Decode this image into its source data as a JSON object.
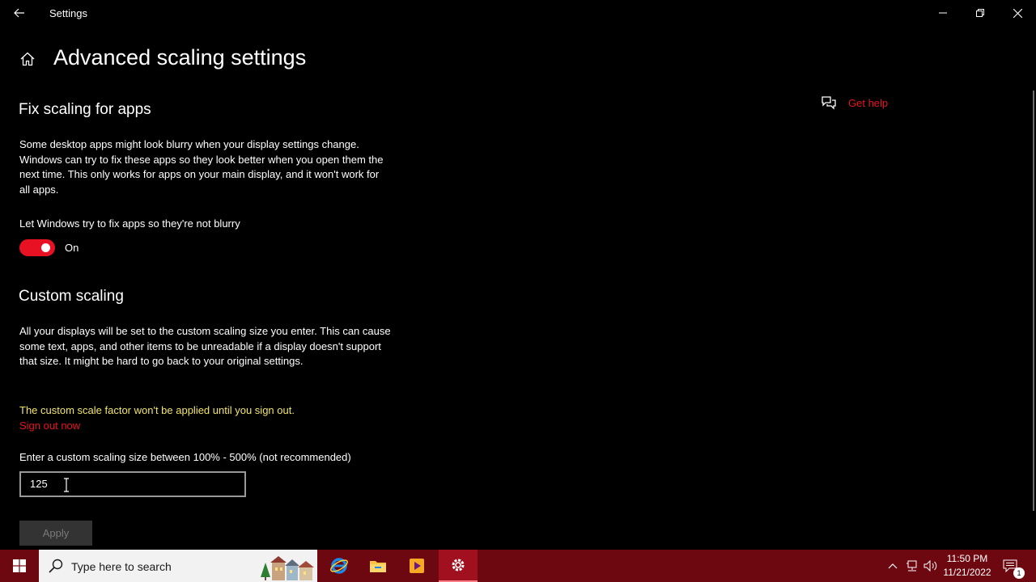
{
  "titlebar": {
    "app_title": "Settings"
  },
  "header": {
    "page_title": "Advanced scaling settings"
  },
  "fix_scaling": {
    "heading": "Fix scaling for apps",
    "description": "Some desktop apps might look blurry when your display settings change. Windows can try to fix these apps so they look better when you open them the next time. This only works for apps on your main display, and it won't work for all apps.",
    "toggle_label": "Let Windows try to fix apps so they're not blurry",
    "toggle_state": "On"
  },
  "custom_scaling": {
    "heading": "Custom scaling",
    "description": "All your displays will be set to the custom scaling size you enter. This can cause some text, apps, and other items to be unreadable if a display doesn't support that size. It might be hard to go back to your original settings.",
    "warning": "The custom scale factor won't be applied until you sign out.",
    "sign_out_link": "Sign out now",
    "input_label": "Enter a custom scaling size between 100% - 500% (not recommended)",
    "input_value": "125",
    "apply_label": "Apply"
  },
  "help": {
    "label": "Get help",
    "icon": "chat-help-icon"
  },
  "taskbar": {
    "search_placeholder": "Type here to search",
    "time": "11:50 PM",
    "date": "11/21/2022",
    "notification_count": "1"
  },
  "colors": {
    "accent": "#e81123",
    "warning": "#f2e469",
    "taskbar": "#6e0810"
  }
}
